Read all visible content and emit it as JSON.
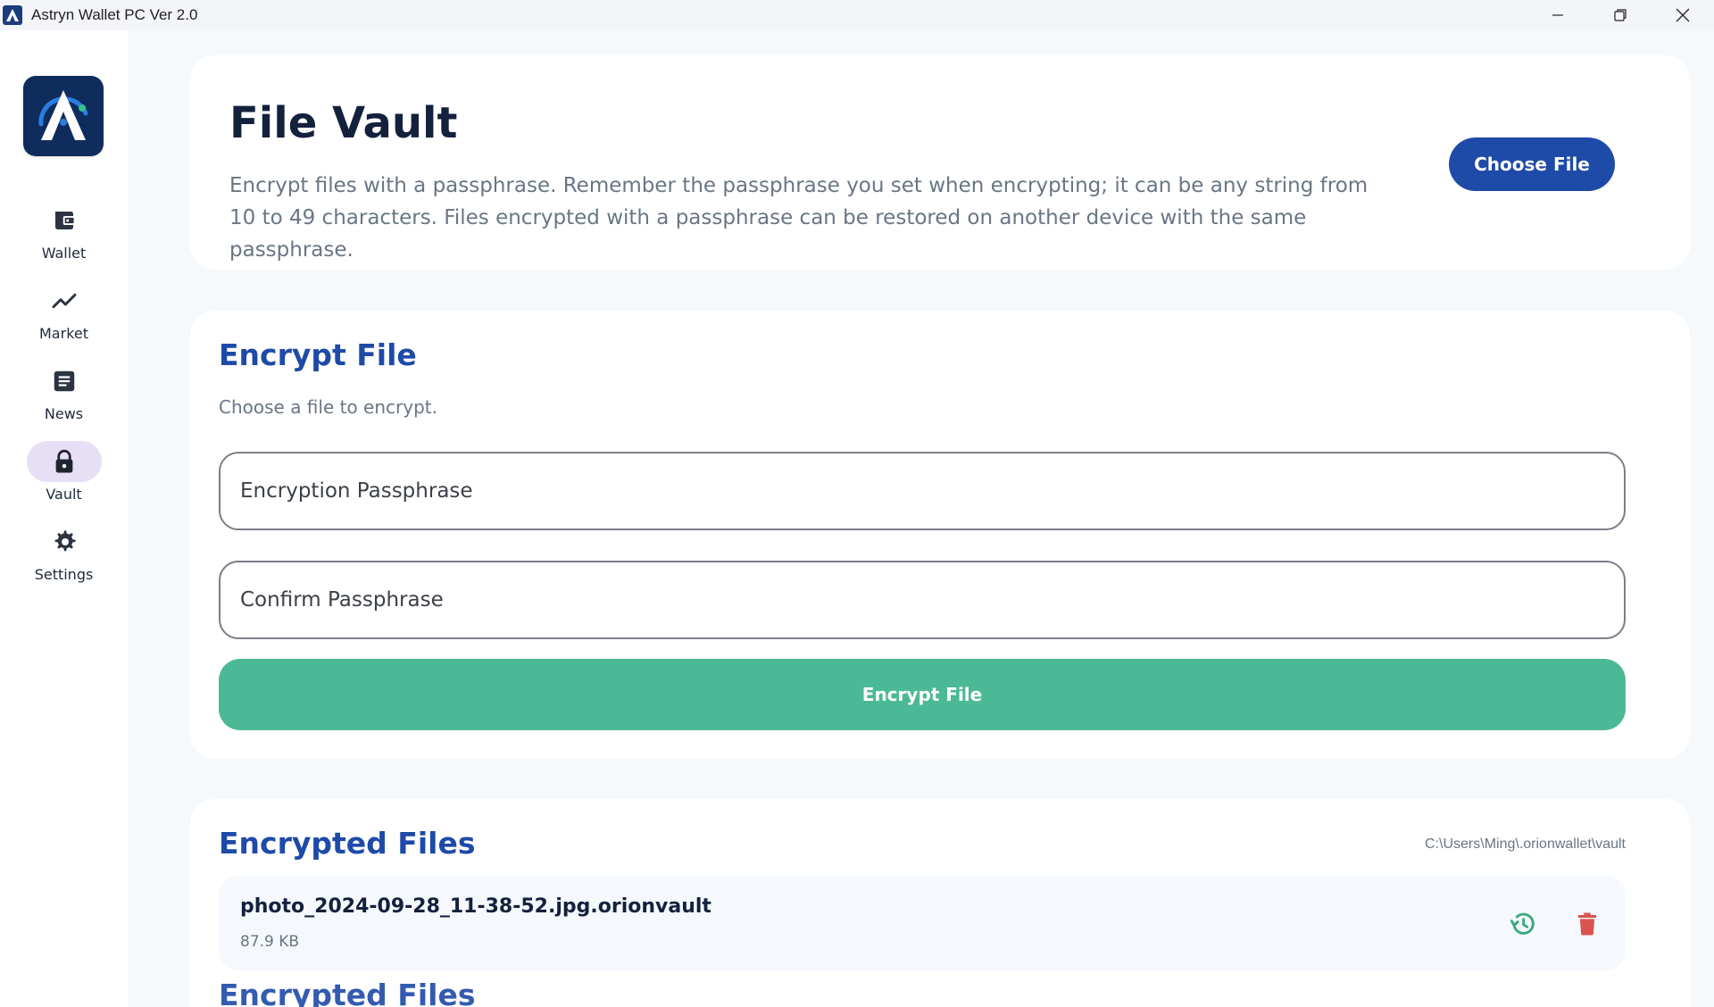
{
  "window": {
    "title": "Astryn Wallet PC Ver 2.0"
  },
  "sidebar": {
    "items": [
      {
        "label": "Wallet",
        "icon": "wallet-icon"
      },
      {
        "label": "Market",
        "icon": "trending-up-icon"
      },
      {
        "label": "News",
        "icon": "article-icon"
      },
      {
        "label": "Vault",
        "icon": "lock-icon",
        "active": true
      },
      {
        "label": "Settings",
        "icon": "gear-icon"
      }
    ]
  },
  "header": {
    "title": "File Vault",
    "description": "Encrypt files with a passphrase. Remember the passphrase you set when encrypting; it can be any string from 10 to 49 characters. Files encrypted with a passphrase can be restored on another device with the same passphrase.",
    "choose_file_label": "Choose File"
  },
  "encrypt": {
    "title": "Encrypt File",
    "subtitle": "Choose a file to encrypt.",
    "passphrase_placeholder": "Encryption Passphrase",
    "confirm_placeholder": "Confirm Passphrase",
    "button_label": "Encrypt File"
  },
  "files": {
    "title": "Encrypted Files",
    "path": "C:\\Users\\Ming\\.orionwallet\\vault",
    "items": [
      {
        "name": "photo_2024-09-28_11-38-52.jpg.orionvault",
        "size": "87.9 KB"
      }
    ],
    "next_title": "Encrypted Files"
  },
  "colors": {
    "primary": "#1e4aa8",
    "success": "#4cb996",
    "danger": "#d9534f",
    "restore": "#3daa7f",
    "nav_active_bg": "#e7dff5"
  }
}
